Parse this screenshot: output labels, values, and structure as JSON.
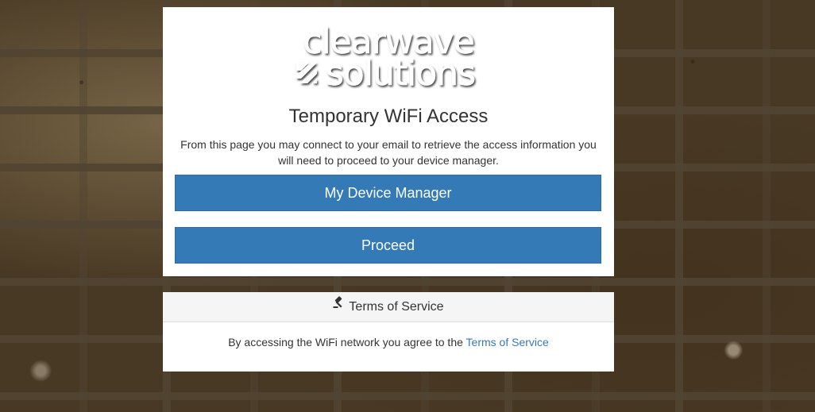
{
  "brand": {
    "logo_line1": "clearwave",
    "logo_line2": "solutions"
  },
  "card": {
    "title": "Temporary WiFi Access",
    "description": "From this page you may connect to your email to retrieve the access information you will need to proceed to your device manager.",
    "device_manager_label": "My Device Manager",
    "proceed_label": "Proceed"
  },
  "terms": {
    "header_label": "Terms of Service",
    "header_icon": "gavel-icon",
    "body_text": "By accessing the WiFi network you agree to the ",
    "link_label": "Terms of Service"
  },
  "colors": {
    "primary_button": "#337ab7",
    "link": "#337ab7",
    "panel_header": "#f5f5f5"
  }
}
